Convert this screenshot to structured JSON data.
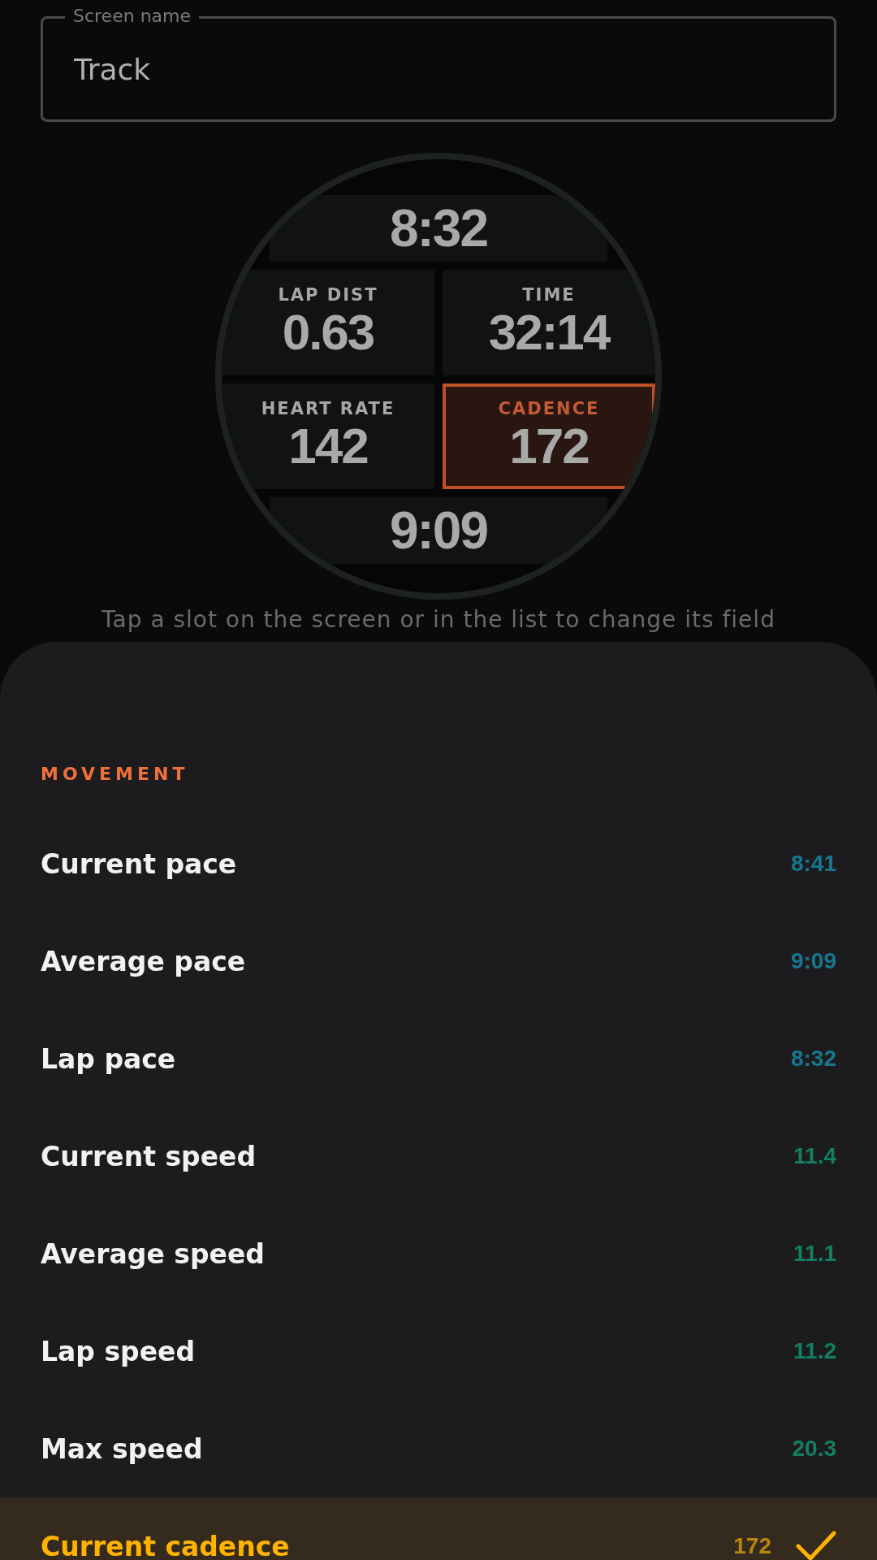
{
  "screen_name_field": {
    "label": "Screen name",
    "value": "Track"
  },
  "watch_slots": [
    {
      "kind": "wide",
      "value": "8:32",
      "selected": false
    },
    {
      "kind": "half",
      "label": "LAP DIST",
      "value": "0.63",
      "selected": false
    },
    {
      "kind": "half",
      "label": "TIME",
      "value": "32:14",
      "selected": false
    },
    {
      "kind": "half",
      "label": "HEART RATE",
      "value": "142",
      "selected": false
    },
    {
      "kind": "half",
      "label": "CADENCE",
      "value": "172",
      "selected": true
    },
    {
      "kind": "wide",
      "value": "9:09",
      "selected": false
    }
  ],
  "hint": "Tap a slot on the screen or in the list to change its field",
  "sheet": {
    "section": "MOVEMENT",
    "fields": [
      {
        "name": "Current pace",
        "value": "8:41",
        "color": "#17778f",
        "selected": false
      },
      {
        "name": "Average pace",
        "value": "9:09",
        "color": "#17778f",
        "selected": false
      },
      {
        "name": "Lap pace",
        "value": "8:32",
        "color": "#17778f",
        "selected": false
      },
      {
        "name": "Current speed",
        "value": "11.4",
        "color": "#12805f",
        "selected": false
      },
      {
        "name": "Average speed",
        "value": "11.1",
        "color": "#12805f",
        "selected": false
      },
      {
        "name": "Lap speed",
        "value": "11.2",
        "color": "#12805f",
        "selected": false
      },
      {
        "name": "Max speed",
        "value": "20.3",
        "color": "#12805f",
        "selected": false
      },
      {
        "name": "Current cadence",
        "value": "172",
        "color": "#b8860b",
        "selected": true
      }
    ]
  }
}
